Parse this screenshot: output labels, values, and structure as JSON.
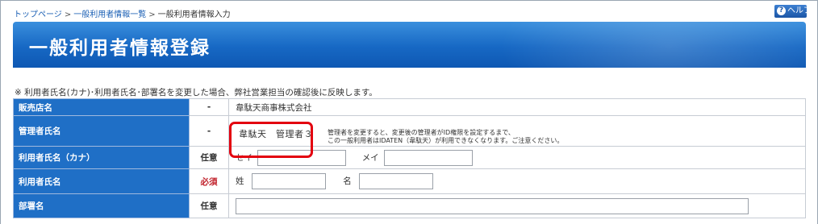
{
  "breadcrumb": {
    "items": [
      {
        "label": "トップページ",
        "link": true
      },
      {
        "label": "一般利用者情報一覧",
        "link": true
      },
      {
        "label": "一般利用者情報入力",
        "link": false
      }
    ],
    "separator": ">"
  },
  "help": {
    "label": "ヘルプ",
    "icon": "question-icon"
  },
  "page": {
    "title": "一般利用者情報登録"
  },
  "notice": "※ 利用者氏名(カナ)･利用者氏名･部署名を変更した場合、弊社営業担当の確認後に反映します。",
  "form": {
    "rows": [
      {
        "label": "販売店名",
        "requirement": "-",
        "value": "韋駄天商事株式会社"
      },
      {
        "label": "管理者氏名",
        "requirement": "-",
        "value": "韋駄天　管理者３",
        "note_line1": "管理者を変更すると、変更後の管理者がID権限を設定するまで、",
        "note_line2": "この一般利用者はIDATEN（韋駄天）が利用できなくなります。ご注意ください。"
      },
      {
        "label": "利用者氏名（カナ）",
        "requirement": "任意",
        "first_label": "セイ",
        "first_value": "",
        "second_label": "メイ",
        "second_value": ""
      },
      {
        "label": "利用者氏名",
        "requirement": "必須",
        "first_label": "姓",
        "first_value": "",
        "second_label": "名",
        "second_value": ""
      },
      {
        "label": "部署名",
        "requirement": "任意",
        "value": ""
      }
    ]
  },
  "colors": {
    "banner": "#1768c4",
    "label_bg": "#1f6fc6",
    "required": "#c0202a",
    "highlight": "#e3000f"
  }
}
